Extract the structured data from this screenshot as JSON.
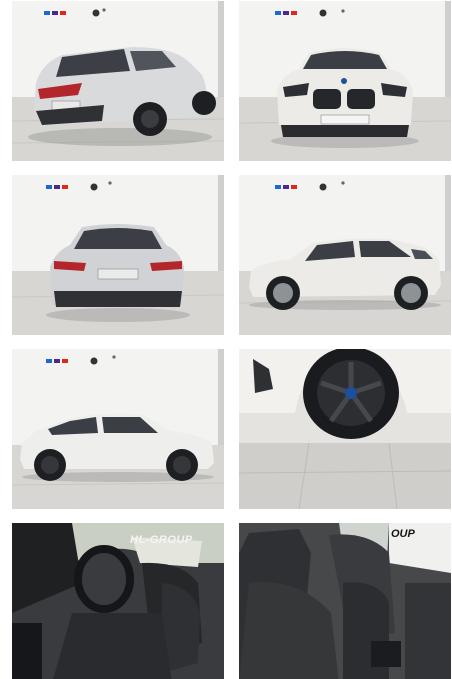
{
  "gallery": {
    "photos": [
      {
        "view": "rear-three-quarter"
      },
      {
        "view": "front"
      },
      {
        "view": "rear"
      },
      {
        "view": "side-profile"
      },
      {
        "view": "side-left"
      },
      {
        "view": "wheel-detail"
      },
      {
        "view": "interior-driver"
      },
      {
        "view": "interior-front-seats"
      }
    ],
    "watermarks": {
      "interior_driver": "HL-GROUP",
      "interior_seats": "OUP"
    }
  },
  "colors": {
    "car_body": "#e9e8e4",
    "car_silver": "#cfd0d2",
    "showroom_wall": "#f2f2f0",
    "showroom_floor": "#d6d5d1",
    "interior_dark": "#2b2c2e",
    "bmw_m_blue": "#1c69d4",
    "bmw_m_purple": "#4b2a8c",
    "bmw_m_red": "#e22718"
  }
}
